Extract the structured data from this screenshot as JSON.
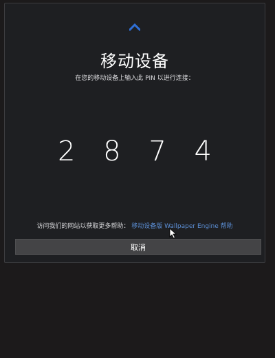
{
  "dialog": {
    "logo_icon": "wallpaper-engine-chevron-up-icon",
    "title": "移动设备",
    "subtitle": "在您的移动设备上输入此 PIN 以进行连接：",
    "pin": "2 8 7 4",
    "help_prefix": "访问我们的网站以获取更多帮助：",
    "help_link": "移动设备版 Wallpaper Engine 帮助",
    "cancel_label": "取消"
  },
  "colors": {
    "background": "#1c1a1b",
    "dialog_bg": "#1e1f22",
    "accent": "#2f6fd6",
    "link": "#5c8fd6",
    "button_bg": "#444446"
  }
}
